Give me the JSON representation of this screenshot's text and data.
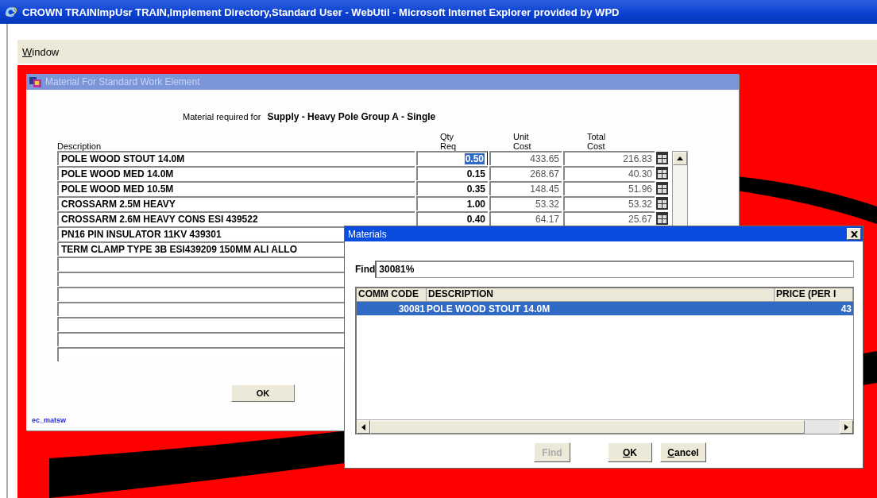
{
  "window": {
    "title": "CROWN TRAINImpUsr TRAIN,Implement Directory,Standard User - WebUtil - Microsoft Internet Explorer provided by WPD"
  },
  "menu": [
    {
      "label": "Window",
      "mnemonic": true
    }
  ],
  "material_window": {
    "title": "Material For Standard Work Element",
    "caption_label": "Material required for",
    "caption_value": "Supply - Heavy Pole Group A - Single",
    "columns": [
      {
        "label": "Description"
      },
      {
        "label": "Qty\nReq"
      },
      {
        "label": "Unit\nCost"
      },
      {
        "label": "Total\nCost"
      }
    ],
    "rows": [
      {
        "kind": "item",
        "description": "POLE WOOD STOUT 14.0M",
        "qty": "0.50",
        "unit_cost": "433.65",
        "total_cost": "216.83",
        "selected": true
      },
      {
        "kind": "item",
        "description": "POLE WOOD MED 14.0M",
        "qty": "0.15",
        "unit_cost": "268.67",
        "total_cost": "40.30",
        "selected": false
      },
      {
        "kind": "item",
        "description": "POLE WOOD MED 10.5M",
        "qty": "0.35",
        "unit_cost": "148.45",
        "total_cost": "51.96",
        "selected": false
      },
      {
        "kind": "item",
        "description": "CROSSARM 2.5M HEAVY",
        "qty": "1.00",
        "unit_cost": "53.32",
        "total_cost": "53.32",
        "selected": false
      },
      {
        "kind": "item",
        "description": "CROSSARM 2.6M HEAVY CONS ESI 439522",
        "qty": "0.40",
        "unit_cost": "64.17",
        "total_cost": "25.67",
        "selected": false
      },
      {
        "kind": "item",
        "description": "PN16 PIN INSULATOR 11KV 439301"
      },
      {
        "kind": "item",
        "description": "TERM CLAMP TYPE 3B ESI439209 150MM ALI ALLO"
      },
      {
        "kind": "empty"
      },
      {
        "kind": "empty"
      },
      {
        "kind": "empty"
      },
      {
        "kind": "empty"
      },
      {
        "kind": "empty"
      },
      {
        "kind": "empty"
      },
      {
        "kind": "empty"
      }
    ],
    "buttons": [
      {
        "label": "OK",
        "mnemonic": false
      }
    ],
    "form_name": "ec_matsw"
  },
  "materials_dialog": {
    "title": "Materials",
    "find_label": "Find",
    "find_value": "30081%",
    "columns": [
      {
        "label": "COMM CODE"
      },
      {
        "label": "DESCRIPTION"
      },
      {
        "label": "PRICE (PER I"
      }
    ],
    "rows": [
      {
        "comm_code": "30081",
        "description": "POLE WOOD STOUT 14.0M",
        "price": "43",
        "selected": true
      }
    ],
    "buttons": [
      {
        "label": "Find",
        "disabled": true,
        "mnemonic": false
      },
      {
        "label": "OK",
        "disabled": false,
        "mnemonic": true
      },
      {
        "label": "Cancel",
        "disabled": false,
        "mnemonic": true
      }
    ]
  }
}
